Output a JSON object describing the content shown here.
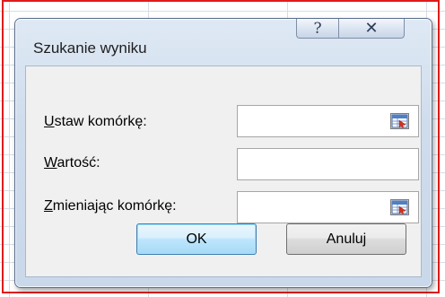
{
  "dialog": {
    "title": "Szukanie wyniku",
    "help_icon": "question-icon",
    "close_icon": "close-icon",
    "help_glyph": "?",
    "close_glyph": "✕"
  },
  "fields": [
    {
      "label_mnemonic": "U",
      "label_rest": "staw komórkę:",
      "value": "",
      "has_ref_button": true
    },
    {
      "label_mnemonic": "W",
      "label_rest": "artość:",
      "value": "",
      "has_ref_button": false
    },
    {
      "label_mnemonic": "Z",
      "label_rest": "mieniając komórkę:",
      "value": "",
      "has_ref_button": true
    }
  ],
  "buttons": {
    "ok_label": "OK",
    "cancel_label": "Anuluj"
  },
  "colors": {
    "highlight_frame": "#e01b1b",
    "ok_button_accent": "#3c7fb1"
  }
}
